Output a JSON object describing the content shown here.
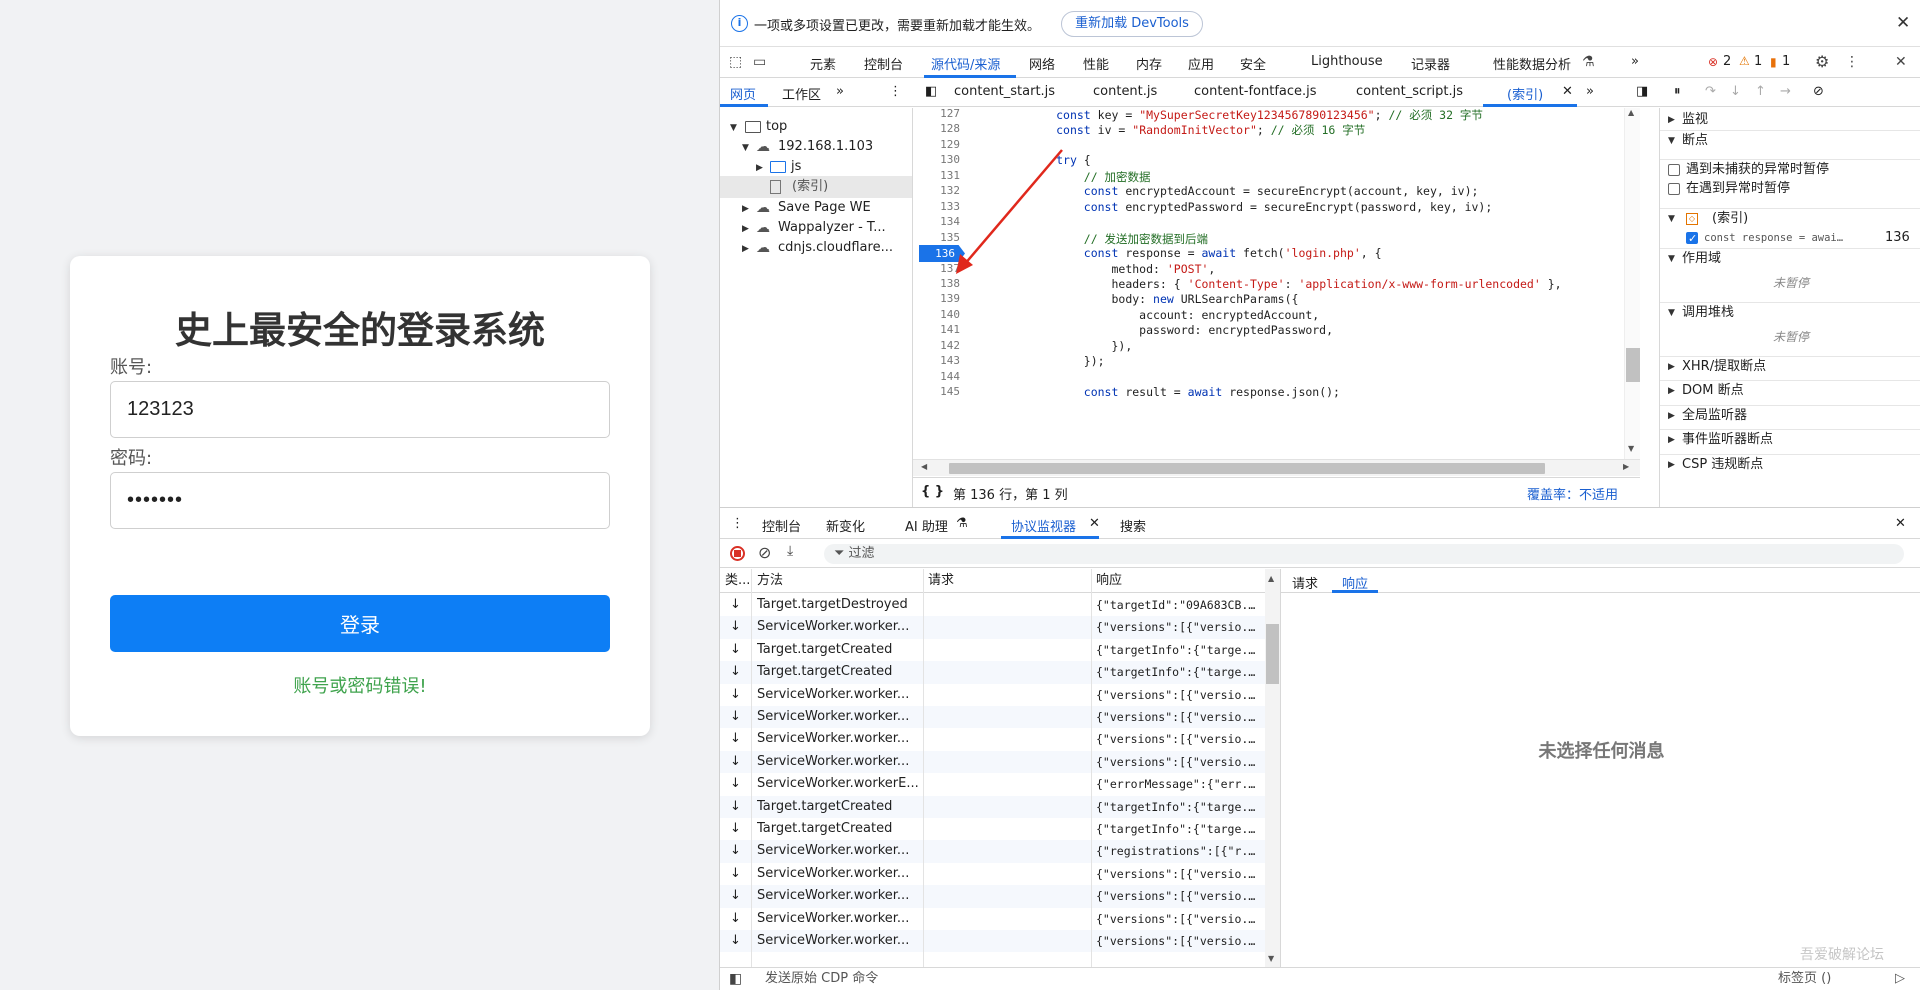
{
  "login": {
    "title": "史上最安全的登录系统",
    "account_label": "账号:",
    "account_value": "123123",
    "password_label": "密码:",
    "password_value": "•••••••",
    "login_button": "登录",
    "error_message": "账号或密码错误!"
  },
  "infobar": {
    "text": "一项或多项设置已更改，需要重新加载才能生效。",
    "reload_button": "重新加载 DevTools"
  },
  "top_tabs": [
    "元素",
    "控制台",
    "源代码/来源",
    "网络",
    "性能",
    "内存",
    "应用",
    "安全",
    "Lighthouse",
    "记录器",
    "性能数据分析"
  ],
  "top_tabs_more": "»",
  "counts": {
    "errors": "2",
    "warnings": "1",
    "issues": "1"
  },
  "navigator_tabs": [
    "网页",
    "工作区"
  ],
  "file_tabs": [
    "content_start.js",
    "content.js",
    "content-fontface.js",
    "content_script.js",
    "(索引)"
  ],
  "tree": [
    {
      "label": "top",
      "depth": 0,
      "expanded": true
    },
    {
      "label": "192.168.1.103",
      "depth": 1,
      "expanded": true
    },
    {
      "label": "js",
      "depth": 2,
      "expanded": false
    },
    {
      "label": "(索引)",
      "depth": 2,
      "expanded": null
    },
    {
      "label": "Save Page WE",
      "depth": 1,
      "expanded": false
    },
    {
      "label": "Wappalyzer - T...",
      "depth": 1,
      "expanded": false
    },
    {
      "label": "cdnjs.cloudflare...",
      "depth": 1,
      "expanded": false
    }
  ],
  "code_lines": [
    {
      "n": "127",
      "t": "            const key = \"MySuperSecretKey1234567890123456\"; // 必须 32 字节"
    },
    {
      "n": "128",
      "t": "            const iv = \"RandomInitVector\"; // 必须 16 字节"
    },
    {
      "n": "129",
      "t": ""
    },
    {
      "n": "130",
      "t": "            try {"
    },
    {
      "n": "131",
      "t": "                // 加密数据"
    },
    {
      "n": "132",
      "t": "                const encryptedAccount = secureEncrypt(account, key, iv);"
    },
    {
      "n": "133",
      "t": "                const encryptedPassword = secureEncrypt(password, key, iv);"
    },
    {
      "n": "134",
      "t": ""
    },
    {
      "n": "135",
      "t": "                // 发送加密数据到后端"
    },
    {
      "n": "136",
      "t": "                const response = await fetch('login.php', {"
    },
    {
      "n": "137",
      "t": "                    method: 'POST',"
    },
    {
      "n": "138",
      "t": "                    headers: { 'Content-Type': 'application/x-www-form-urlencoded' },"
    },
    {
      "n": "139",
      "t": "                    body: new URLSearchParams({"
    },
    {
      "n": "140",
      "t": "                        account: encryptedAccount,"
    },
    {
      "n": "141",
      "t": "                        password: encryptedPassword,"
    },
    {
      "n": "142",
      "t": "                    }),"
    },
    {
      "n": "143",
      "t": "                });"
    },
    {
      "n": "144",
      "t": ""
    },
    {
      "n": "145",
      "t": "                const result = await response.json();"
    }
  ],
  "breakpoint_line": "136",
  "code_status": {
    "position": "第 136 行，第 1 列",
    "coverage": "覆盖率：不适用"
  },
  "sidebar": {
    "watch": "监视",
    "breakpoints": "断点",
    "pause_uncaught": "遇到未捕获的异常时暂停",
    "pause_caught": "在遇到异常时暂停",
    "bp_file": "(索引)",
    "bp_code": "const response = awai…",
    "bp_line": "136",
    "scope": "作用域",
    "not_paused_1": "未暂停",
    "call_stack": "调用堆栈",
    "not_paused_2": "未暂停",
    "xhr": "XHR/提取断点",
    "dom": "DOM 断点",
    "global": "全局监听器",
    "event": "事件监听器断点",
    "csp": "CSP 违规断点"
  },
  "drawer_tabs": [
    "控制台",
    "新变化",
    "AI 助理",
    "协议监视器",
    "搜索"
  ],
  "filter_placeholder": "过滤",
  "protocol_headers": {
    "type": "类...",
    "method": "方法",
    "request": "请求",
    "response": "响应"
  },
  "protocol_rows": [
    {
      "method": "Target.targetDestroyed",
      "response": "{\"targetId\":\"09A683CB..."
    },
    {
      "method": "ServiceWorker.worker...",
      "response": "{\"versions\":[{\"versio..."
    },
    {
      "method": "Target.targetCreated",
      "response": "{\"targetInfo\":{\"targe..."
    },
    {
      "method": "Target.targetCreated",
      "response": "{\"targetInfo\":{\"targe..."
    },
    {
      "method": "ServiceWorker.worker...",
      "response": "{\"versions\":[{\"versio..."
    },
    {
      "method": "ServiceWorker.worker...",
      "response": "{\"versions\":[{\"versio..."
    },
    {
      "method": "ServiceWorker.worker...",
      "response": "{\"versions\":[{\"versio..."
    },
    {
      "method": "ServiceWorker.worker...",
      "response": "{\"versions\":[{\"versio..."
    },
    {
      "method": "ServiceWorker.workerE...",
      "response": "{\"errorMessage\":{\"err..."
    },
    {
      "method": "Target.targetCreated",
      "response": "{\"targetInfo\":{\"targe..."
    },
    {
      "method": "Target.targetCreated",
      "response": "{\"targetInfo\":{\"targe..."
    },
    {
      "method": "ServiceWorker.worker...",
      "response": "{\"registrations\":[{\"r..."
    },
    {
      "method": "ServiceWorker.worker...",
      "response": "{\"versions\":[{\"versio..."
    },
    {
      "method": "ServiceWorker.worker...",
      "response": "{\"versions\":[{\"versio..."
    },
    {
      "method": "ServiceWorker.worker...",
      "response": "{\"versions\":[{\"versio..."
    },
    {
      "method": "ServiceWorker.worker...",
      "response": "{\"versions\":[{\"versio..."
    }
  ],
  "detail_tabs": [
    "请求",
    "响应"
  ],
  "no_message": "未选择任何消息",
  "cdp_command": "发送原始 CDP 命令",
  "target_label": "标签页 ()",
  "watermark": "吾爱破解论坛"
}
